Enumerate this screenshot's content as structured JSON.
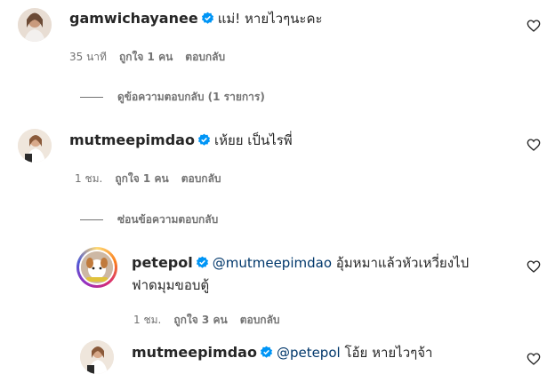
{
  "comments": [
    {
      "username": "gamwichayanee",
      "text": "แม่! หายไวๆนะคะ",
      "time": "35 นาที",
      "likes": "ถูกใจ 1 คน",
      "reply": "ตอบกลับ"
    },
    {
      "username": "mutmeepimdao",
      "text": "เห้ยย เป็นไรพี่",
      "time": "1 ชม.",
      "likes": "ถูกใจ 1 คน",
      "reply": "ตอบกลับ"
    }
  ],
  "toggles": {
    "view_replies": "ดูข้อความตอบกลับ (1 รายการ)",
    "hide_replies": "ซ่อนข้อความตอบกลับ"
  },
  "replies": [
    {
      "username": "petepol",
      "mention": "@mutmeepimdao",
      "text_line1": "อุ้มหมาแล้วหัวเหวี่ยงไป",
      "text_line2": "ฟาดมุมขอบตู้",
      "time": "1 ชม.",
      "likes": "ถูกใจ 3 คน",
      "reply": "ตอบกลับ"
    },
    {
      "username": "mutmeepimdao",
      "mention": "@petepol",
      "text": "โอ้ย หายไวๆจ้า"
    }
  ],
  "colors": {
    "text": "#262626",
    "secondary": "#737373",
    "mention": "#00376b",
    "verified": "#0095f6"
  },
  "icons": [
    "verified-badge-icon",
    "heart-outline-icon"
  ]
}
